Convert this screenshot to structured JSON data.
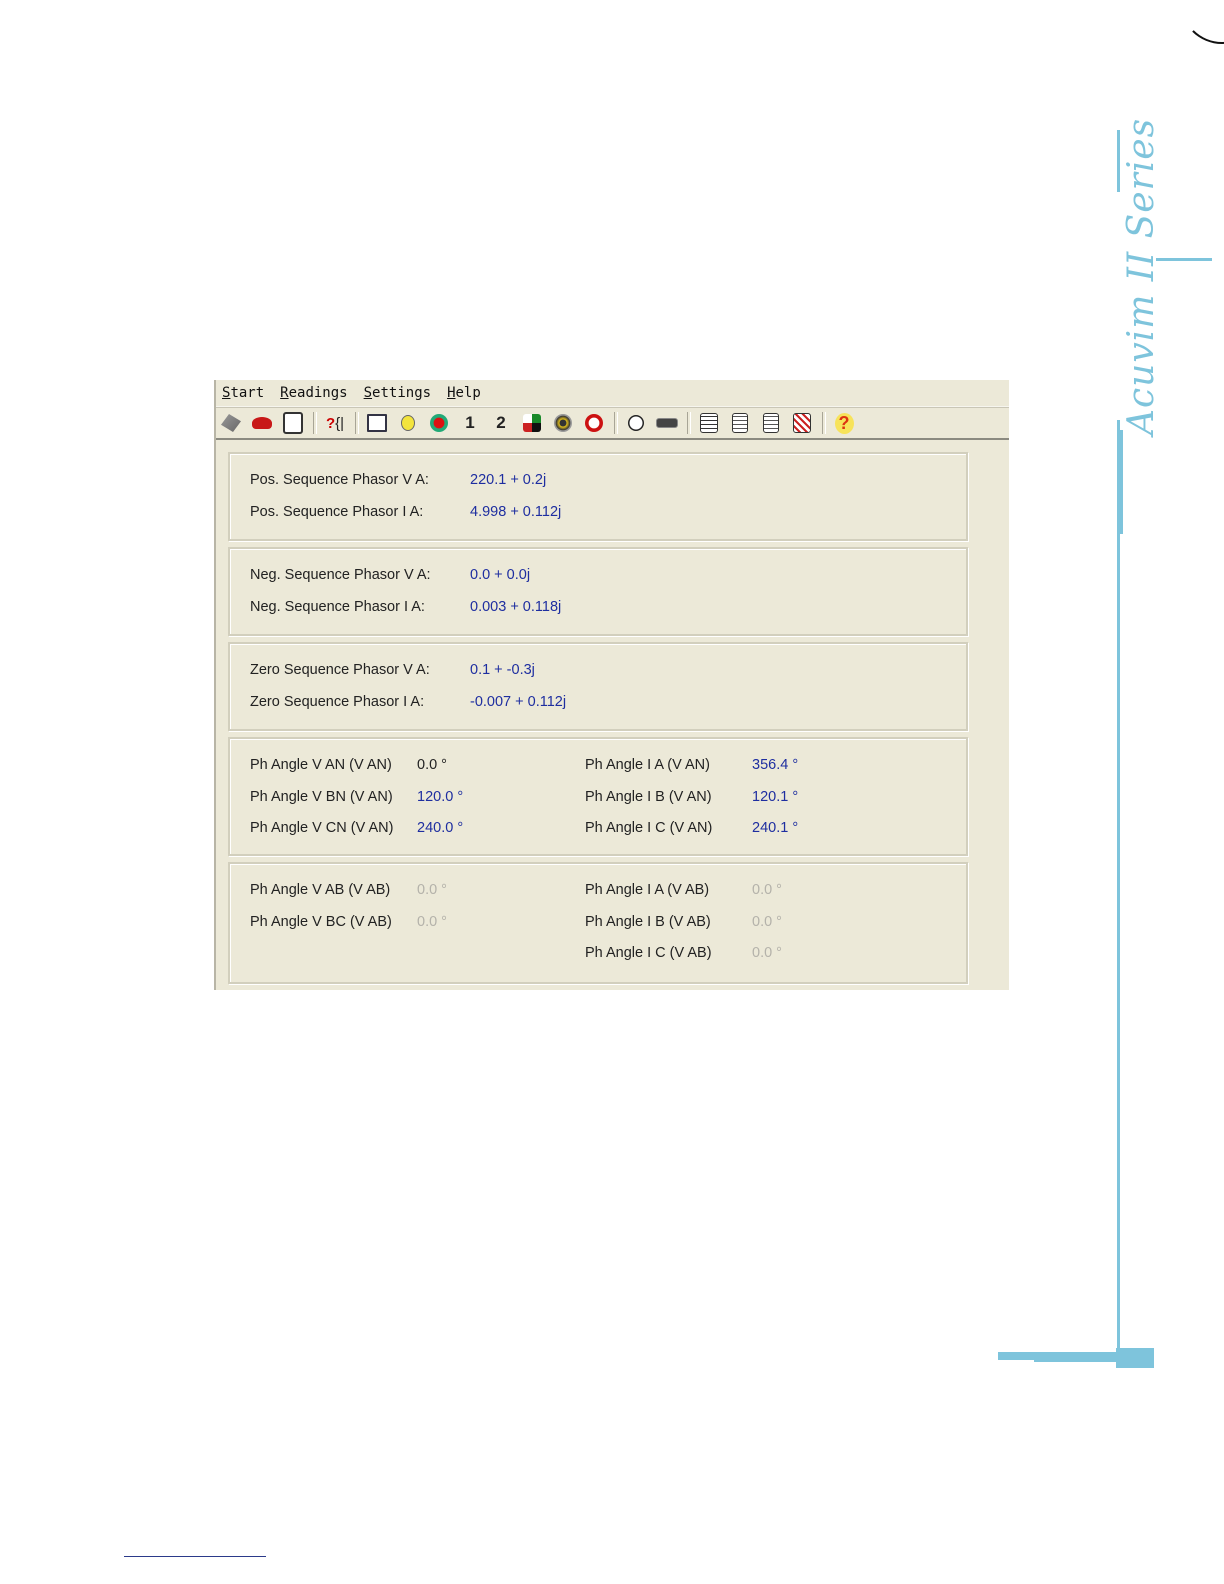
{
  "brand": "Acuvim II Series",
  "menu": [
    "Start",
    "Readings",
    "Settings",
    "Help"
  ],
  "toolbar": {
    "icons": [
      "connect-icon",
      "phone-icon",
      "device-icon",
      "help-brackets-icon",
      "meter-icon",
      "bulb-icon",
      "bug-icon",
      "page-1-icon",
      "page-2-icon",
      "network-icon",
      "record-icon",
      "alarm-clock-icon",
      "clock-icon",
      "display-icon",
      "log-icon",
      "doc-1-icon",
      "doc-2-icon",
      "clear-icon",
      "help-icon"
    ],
    "one": "1",
    "two": "2",
    "help": "?"
  },
  "sequence": {
    "pos_v_label": "Pos. Sequence Phasor V A:",
    "pos_v_value": "220.1 + 0.2j",
    "pos_i_label": "Pos. Sequence Phasor I A:",
    "pos_i_value": "4.998 + 0.112j",
    "neg_v_label": "Neg. Sequence Phasor V A:",
    "neg_v_value": "0.0 + 0.0j",
    "neg_i_label": "Neg. Sequence Phasor I A:",
    "neg_i_value": "0.003 + 0.118j",
    "zero_v_label": "Zero Sequence Phasor V A:",
    "zero_v_value": "0.1 + -0.3j",
    "zero_i_label": "Zero Sequence Phasor I A:",
    "zero_i_value": "-0.007 + 0.112j"
  },
  "angles_van": {
    "rows": [
      {
        "v_label": "Ph Angle V AN (V AN)",
        "v_value": "0.0 °",
        "i_label": "Ph Angle I A (V AN)",
        "i_value": "356.4 °"
      },
      {
        "v_label": "Ph Angle V BN (V AN)",
        "v_value": "120.0 °",
        "i_label": "Ph Angle I B (V AN)",
        "i_value": "120.1 °"
      },
      {
        "v_label": "Ph Angle V CN (V AN)",
        "v_value": "240.0 °",
        "i_label": "Ph Angle I C (V AN)",
        "i_value": "240.1 °"
      }
    ]
  },
  "angles_vab": {
    "rows": [
      {
        "v_label": "Ph Angle V AB (V AB)",
        "v_value": "0.0 °",
        "i_label": "Ph Angle I A (V AB)",
        "i_value": "0.0 °"
      },
      {
        "v_label": "Ph Angle V BC (V AB)",
        "v_value": "0.0 °",
        "i_label": "Ph Angle I B (V AB)",
        "i_value": "0.0 °"
      },
      {
        "v_label": "",
        "v_value": "",
        "i_label": "Ph Angle I C (V AB)",
        "i_value": "0.0 °"
      }
    ]
  },
  "colors": {
    "accent": "#7ec4dc",
    "value_blue": "#1e2ea0",
    "window_bg": "#ece9d8",
    "disabled_gray": "#b4b2aa"
  }
}
